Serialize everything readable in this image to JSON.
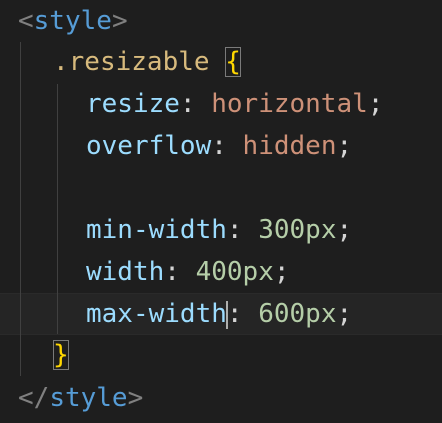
{
  "code": {
    "open_tag": {
      "lt": "<",
      "name": "style",
      "gt": ">"
    },
    "selector": ".resizable",
    "open_brace": "{",
    "close_brace": "}",
    "declarations": [
      {
        "property": "resize",
        "colon": ":",
        "value": "horizontal",
        "semi": ";"
      },
      {
        "property": "overflow",
        "colon": ":",
        "value": "hidden",
        "semi": ";"
      },
      {
        "property": "min-width",
        "colon": ":",
        "value": "300px",
        "semi": ";"
      },
      {
        "property": "width",
        "colon": ":",
        "value": "400px",
        "semi": ";"
      },
      {
        "property": "max-width",
        "colon": ":",
        "value": "600px",
        "semi": ";"
      }
    ],
    "close_tag": {
      "lt": "</",
      "name": "style",
      "gt": ">"
    }
  },
  "colors": {
    "background": "#1e1e1e",
    "tag": "#569cd6",
    "tag_bracket": "#808080",
    "selector": "#d7ba7d",
    "brace": "#ffd700",
    "property": "#9cdcfe",
    "string_value": "#ce9178",
    "number_value": "#b5cea8"
  }
}
